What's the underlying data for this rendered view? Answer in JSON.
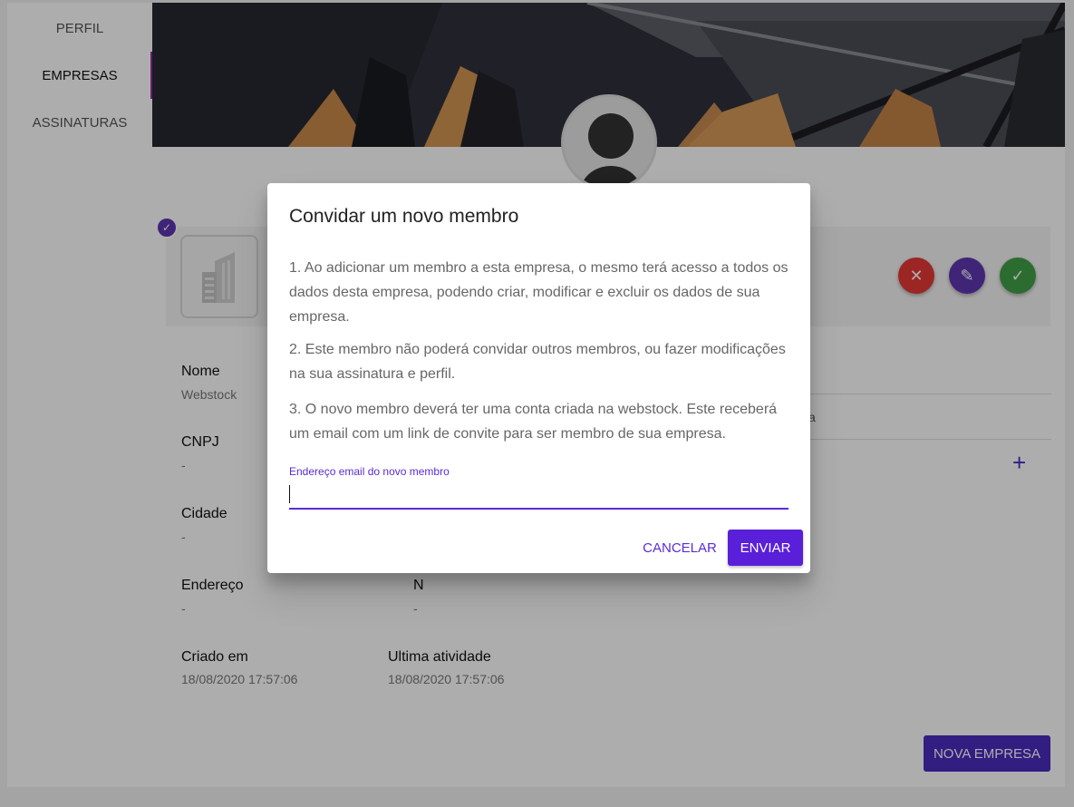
{
  "nav": {
    "items": [
      {
        "label": "PERFIL"
      },
      {
        "label": "EMPRESAS"
      },
      {
        "label": "ASSINATURAS"
      }
    ]
  },
  "colors": {
    "primary": "#5a1fd9",
    "danger": "#e53935",
    "edit": "#5e35b1",
    "confirm": "#43a047"
  },
  "company": {
    "fields": {
      "nome": {
        "label": "Nome",
        "value": "Webstock"
      },
      "cnpj": {
        "label": "CNPJ",
        "value": "-"
      },
      "cidade": {
        "label": "Cidade",
        "value": "-"
      },
      "endereco": {
        "label": "Endereço",
        "value": "-"
      },
      "numero": {
        "label": "N",
        "value": "-"
      },
      "criado": {
        "label": "Criado em",
        "value": "18/08/2020 17:57:06"
      },
      "atividade": {
        "label": "Ultima atividade",
        "value": "18/08/2020 17:57:06"
      }
    },
    "partial_text": "a"
  },
  "actions": {
    "nova_empresa": "NOVA EMPRESA"
  },
  "dialog": {
    "title": "Convidar um novo membro",
    "paragraphs": [
      "1. Ao adicionar um membro a esta empresa, o mesmo terá acesso a todos os dados desta empresa, podendo criar, modificar e excluir os dados de sua empresa.",
      "2. Este membro não poderá convidar outros membros, ou fazer modificações na sua assinatura e perfil.",
      "3. O novo membro deverá ter uma conta criada na webstock. Este receberá um email com um link de convite para ser membro de sua empresa."
    ],
    "email_label": "Endereço email do novo membro",
    "email_value": "",
    "cancel_label": "CANCELAR",
    "send_label": "ENVIAR"
  }
}
